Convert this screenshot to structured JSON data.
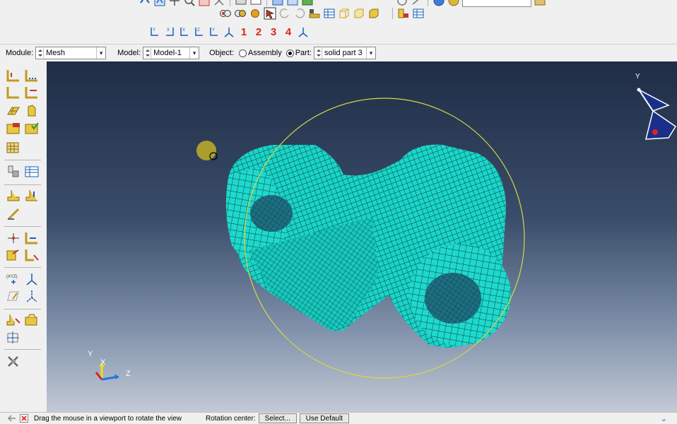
{
  "context_bar": {
    "module_label": "Module:",
    "module_value": "Mesh",
    "model_label": "Model:",
    "model_value": "Model-1",
    "object_label": "Object:",
    "assembly_label": "Assembly",
    "part_label": "Part:",
    "part_value": "solid part 3"
  },
  "view_toolbar": {
    "view_numbers": [
      "1",
      "2",
      "3",
      "4"
    ]
  },
  "viewport": {
    "triad": {
      "y": "Y",
      "x": "X",
      "z": "Z"
    },
    "orient_triad_label": "Y"
  },
  "status_bar": {
    "prompt": "Drag the mouse in a viewport to rotate the view",
    "rotation_center_label": "Rotation center:",
    "select_label": "Select...",
    "use_default_label": "Use Default"
  },
  "colors": {
    "mesh_fill": "#19d4c8",
    "mesh_line": "#0c3a38",
    "viewport_top": "#1f2d46",
    "viewport_bottom": "#c3cad6",
    "rotation_circle": "#d8d64a",
    "accent_red": "#d9261c"
  }
}
